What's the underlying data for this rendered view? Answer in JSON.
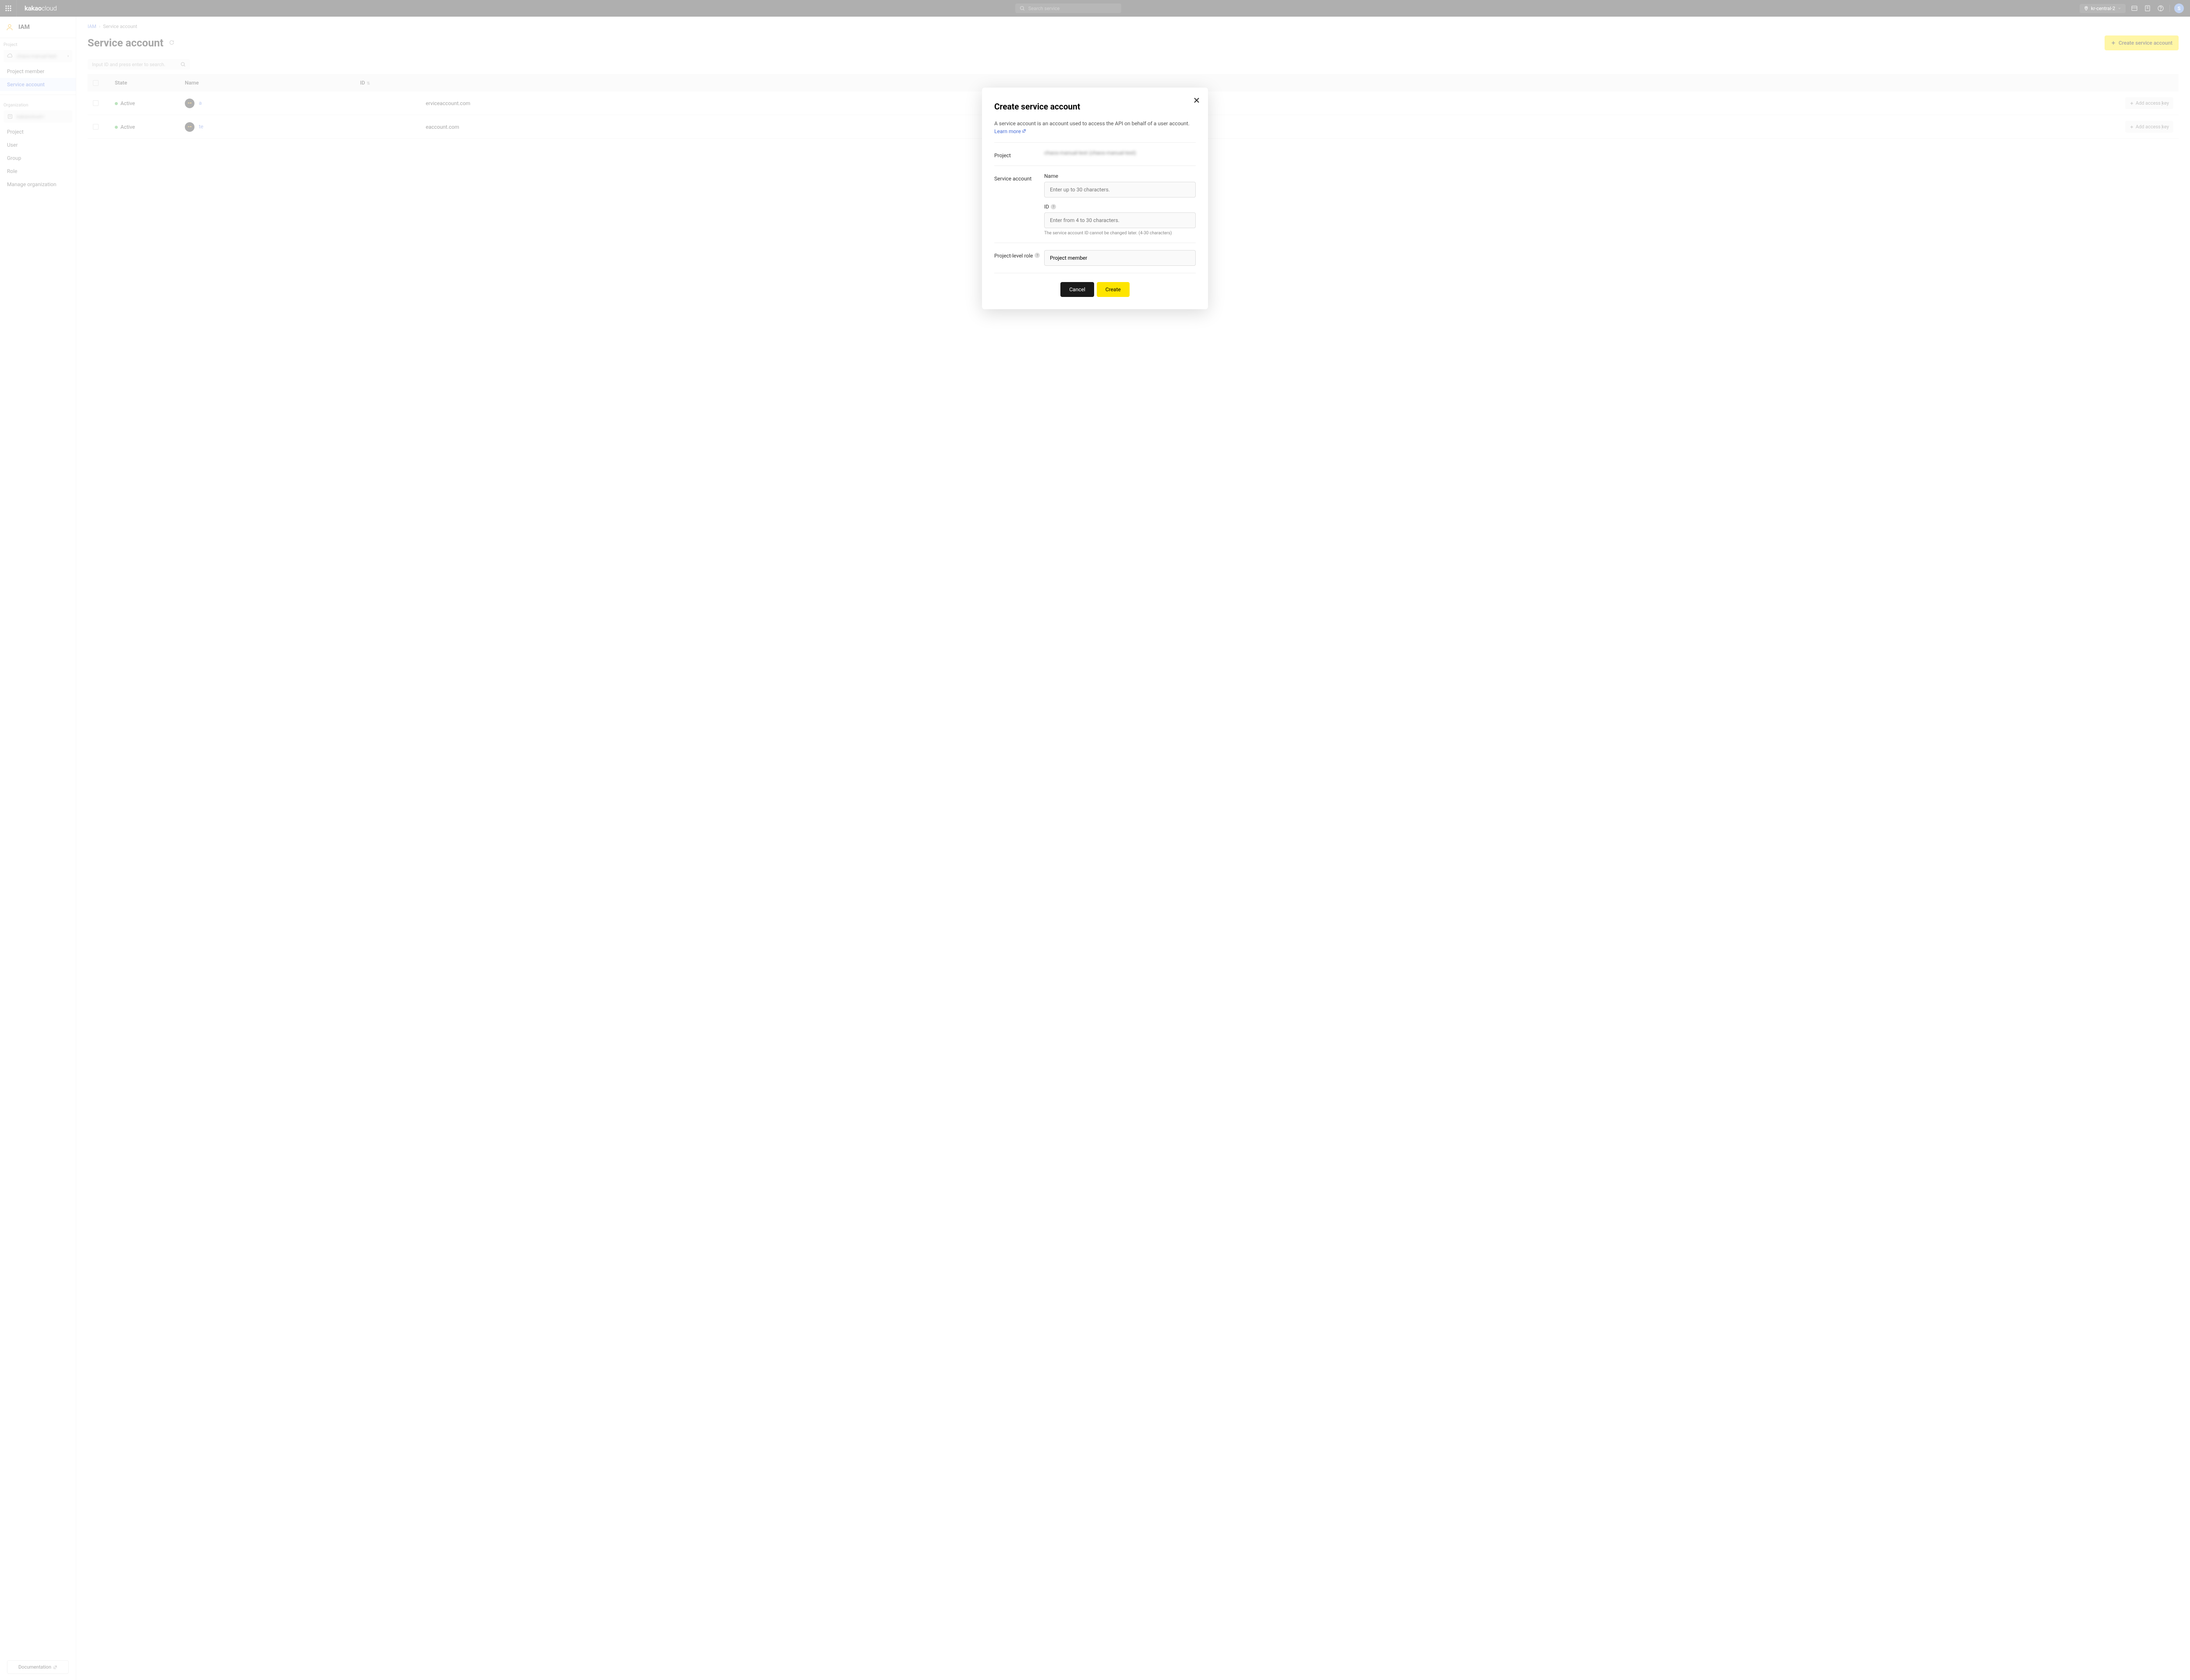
{
  "topbar": {
    "logo_main": "kakao",
    "logo_sub": "cloud",
    "search_placeholder": "Search service",
    "region": "kr-central-2",
    "avatar_initial": "S"
  },
  "sidebar": {
    "service_title": "IAM",
    "section_project": "Project",
    "project_name": "chaos-manual-test",
    "items_project": [
      {
        "label": "Project member",
        "active": false
      },
      {
        "label": "Service account",
        "active": true
      }
    ],
    "section_org": "Organization",
    "org_name": "kakaocloud-r",
    "items_org": [
      {
        "label": "Project"
      },
      {
        "label": "User"
      },
      {
        "label": "Group"
      },
      {
        "label": "Role"
      },
      {
        "label": "Manage organization"
      }
    ],
    "documentation": "Documentation"
  },
  "breadcrumb": {
    "root": "IAM",
    "current": "Service account"
  },
  "page": {
    "title": "Service account",
    "create_btn": "Create service account",
    "search_placeholder": "Input ID and press enter to search.",
    "add_key_btn": "Add access key"
  },
  "table": {
    "headers": {
      "state": "State",
      "name": "Name",
      "id": "ID"
    },
    "rows": [
      {
        "state": "Active",
        "name_prefix": "a",
        "id_suffix": "erviceaccount.com"
      },
      {
        "state": "Active",
        "name_prefix": "te",
        "id_suffix": "eaccount.com"
      }
    ]
  },
  "modal": {
    "title": "Create service account",
    "desc": "A service account is an account used to access the API on behalf of a user account.",
    "learn_more": "Learn more",
    "label_project": "Project",
    "project_value": "chaos-manual-test  (chaos-manual-test)",
    "label_service_account": "Service account",
    "field_name_label": "Name",
    "field_name_placeholder": "Enter up to 30 characters.",
    "field_id_label": "ID",
    "field_id_placeholder": "Enter from 4 to 30 characters.",
    "field_id_hint": "The service account ID cannot be changed later. (4-30 characters)",
    "label_role": "Project-level role",
    "role_value": "Project member",
    "btn_cancel": "Cancel",
    "btn_create": "Create"
  }
}
